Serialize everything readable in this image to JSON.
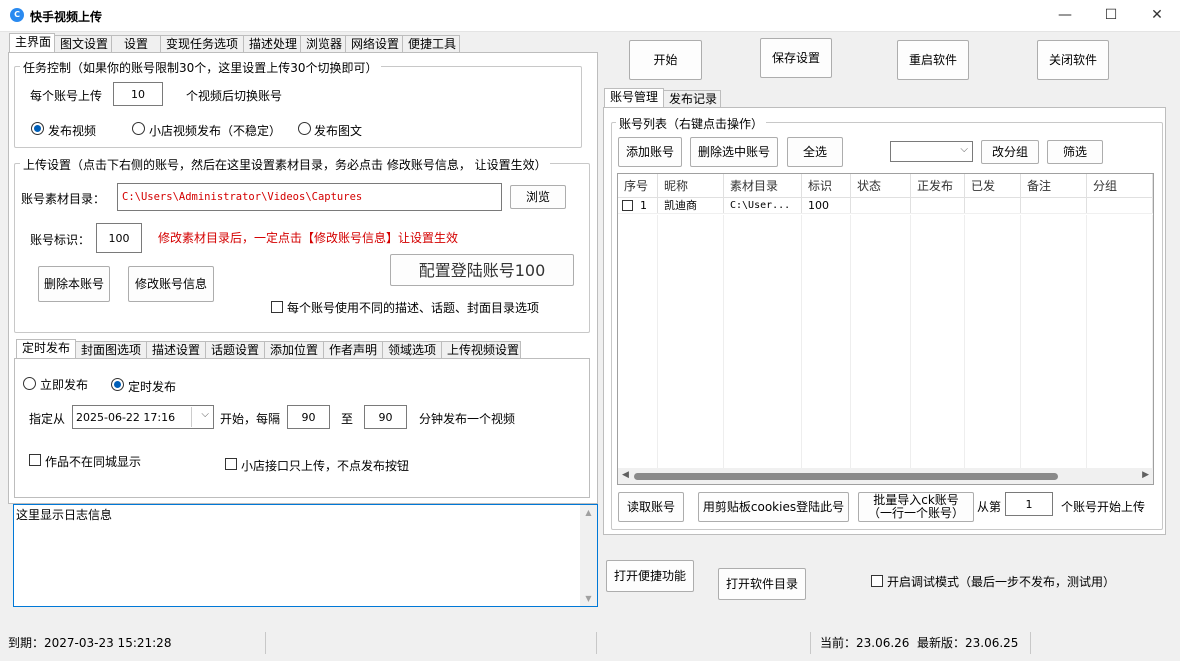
{
  "window": {
    "title": "快手视频上传",
    "icon_text": "C",
    "minimize": "—",
    "maximize": "☐",
    "close": "✕"
  },
  "main_tabs": [
    "主界面",
    "图文设置",
    "设置",
    "变现任务选项",
    "描述处理",
    "浏览器",
    "网络设置",
    "便捷工具"
  ],
  "task_control": {
    "legend": "任务控制（如果你的账号限制30个，这里设置上传30个切换即可）",
    "per_account_label": "每个账号上传",
    "per_account_value": "10",
    "switch_label": "个视频后切换账号",
    "radio_video": "发布视频",
    "radio_shop": "小店视频发布（不稳定）",
    "radio_image": "发布图文"
  },
  "upload_settings": {
    "legend": "上传设置（点击下右侧的账号，然后在这里设置素材目录，务必点击 修改账号信息， 让设置生效）",
    "dir_label": "账号素材目录：",
    "dir_value": "C:\\Users\\Administrator\\Videos\\Captures",
    "browse_button": "浏览",
    "id_label": "账号标识：",
    "id_value": "100",
    "warning": "修改素材目录后，一定点击【修改账号信息】让设置生效",
    "config_button": "配置登陆账号100",
    "delete_button": "删除本账号",
    "modify_button": "修改账号信息",
    "checkbox_diff": "每个账号使用不同的描述、话题、封面目录选项"
  },
  "sub_tabs": [
    "定时发布",
    "封面图选项",
    "描述设置",
    "话题设置",
    "添加位置",
    "作者声明",
    "领域选项",
    "上传视频设置"
  ],
  "schedule": {
    "radio_now": "立即发布",
    "radio_timed": "定时发布",
    "from_label": "指定从",
    "datetime": "2025-06-22 17:16",
    "start_label": "开始，每隔",
    "interval_min": "90",
    "to_label": "至",
    "interval_max": "90",
    "minute_label": "分钟发布一个视频",
    "checkbox_city": "作品不在同城显示",
    "checkbox_shop": "小店接口只上传，不点发布按钮"
  },
  "log": {
    "placeholder": "这里显示日志信息"
  },
  "top_buttons": {
    "start": "开始",
    "save": "保存设置",
    "restart": "重启软件",
    "close": "关闭软件"
  },
  "right_tabs": [
    "账号管理",
    "发布记录"
  ],
  "account_list": {
    "legend": "账号列表（右键点击操作）",
    "add_button": "添加账号",
    "delete_selected": "删除选中账号",
    "select_all": "全选",
    "group_select": "",
    "change_group": "改分组",
    "filter": "筛选",
    "columns": [
      "序号",
      "昵称",
      "素材目录",
      "标识",
      "状态",
      "正发布",
      "已发",
      "备注",
      "分组"
    ],
    "rows": [
      {
        "index": "1",
        "nickname": "凯迪商",
        "dir": "C:\\User...",
        "id": "100",
        "status": "",
        "publishing": "",
        "sent": "",
        "note": "",
        "group": ""
      }
    ],
    "read_button": "读取账号",
    "clipboard_button": "用剪贴板cookies登陆此号",
    "batch_import_line1": "批量导入ck账号",
    "batch_import_line2": "（一行一个账号）",
    "from_label": "从第",
    "from_value": "1",
    "from_suffix": "个账号开始上传"
  },
  "bottom_right": {
    "shortcut_button": "打开便捷功能",
    "dir_button": "打开软件目录",
    "debug_checkbox": "开启调试模式（最后一步不发布，测试用）"
  },
  "status": {
    "expire": "到期：2027-03-23 15:21:28",
    "current": "当前：23.06.26",
    "latest": "最新版：23.06.25"
  }
}
